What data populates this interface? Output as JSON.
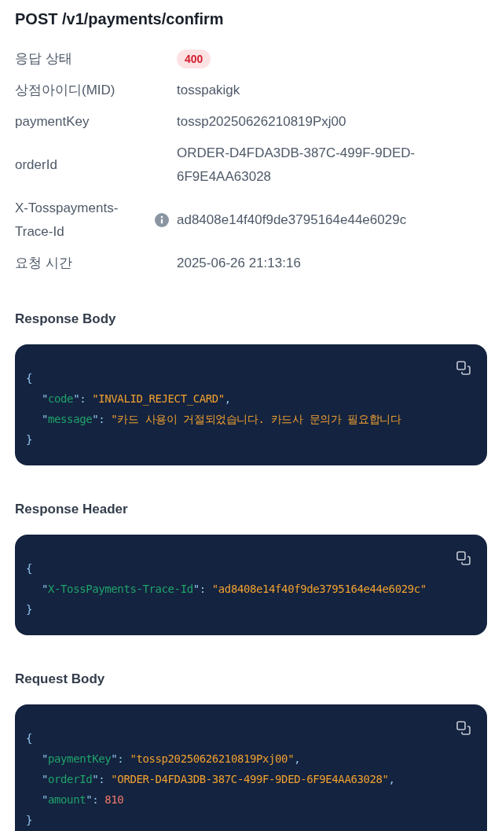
{
  "title": "POST /v1/payments/confirm",
  "fields": [
    {
      "label": "응답 상태",
      "kind": "badge",
      "value": "400",
      "info": false
    },
    {
      "label": "상점아이디(MID)",
      "kind": "text",
      "value": "tosspakigk",
      "info": false
    },
    {
      "label": "paymentKey",
      "kind": "text",
      "value": "tossp20250626210819Pxj00",
      "info": false
    },
    {
      "label": "orderId",
      "kind": "text",
      "value": "ORDER-D4FDA3DB-387C-499F-9DED-6F9E4AA63028",
      "info": false
    },
    {
      "label": "X-Tosspayments-Trace-Id",
      "kind": "text",
      "value": "ad8408e14f40f9de3795164e44e6029c",
      "info": true
    },
    {
      "label": "요청 시간",
      "kind": "text",
      "value": "2025-06-26 21:13:16",
      "info": false
    }
  ],
  "sections": [
    {
      "heading": "Response Body",
      "lines": [
        [
          {
            "kind": "punct",
            "text": "{"
          }
        ],
        [
          {
            "kind": "punct",
            "text": "\""
          },
          {
            "kind": "key",
            "text": "code"
          },
          {
            "kind": "punct",
            "text": "\": "
          },
          {
            "kind": "string",
            "text": "\"INVALID_REJECT_CARD\""
          },
          {
            "kind": "punct",
            "text": ","
          }
        ],
        [
          {
            "kind": "punct",
            "text": "\""
          },
          {
            "kind": "key",
            "text": "message"
          },
          {
            "kind": "punct",
            "text": "\": "
          },
          {
            "kind": "string",
            "text": "\"카드 사용이 거절되었습니다. 카드사 문의가 필요합니다"
          }
        ],
        [
          {
            "kind": "punct",
            "text": "}"
          }
        ]
      ]
    },
    {
      "heading": "Response Header",
      "lines": [
        [
          {
            "kind": "punct",
            "text": "{"
          }
        ],
        [
          {
            "kind": "punct",
            "text": "\""
          },
          {
            "kind": "key",
            "text": "X-TossPayments-Trace-Id"
          },
          {
            "kind": "punct",
            "text": "\": "
          },
          {
            "kind": "string",
            "text": "\"ad8408e14f40f9de3795164e44e6029c\""
          }
        ],
        [
          {
            "kind": "punct",
            "text": "}"
          }
        ]
      ]
    },
    {
      "heading": "Request Body",
      "lines": [
        [
          {
            "kind": "punct",
            "text": "{"
          }
        ],
        [
          {
            "kind": "punct",
            "text": "\""
          },
          {
            "kind": "key",
            "text": "paymentKey"
          },
          {
            "kind": "punct",
            "text": "\": "
          },
          {
            "kind": "string",
            "text": "\"tossp20250626210819Pxj00\""
          },
          {
            "kind": "punct",
            "text": ","
          }
        ],
        [
          {
            "kind": "punct",
            "text": "\""
          },
          {
            "kind": "key",
            "text": "orderId"
          },
          {
            "kind": "punct",
            "text": "\": "
          },
          {
            "kind": "string",
            "text": "\"ORDER-D4FDA3DB-387C-499F-9DED-6F9E4AA63028\""
          },
          {
            "kind": "punct",
            "text": ","
          }
        ],
        [
          {
            "kind": "punct",
            "text": "\""
          },
          {
            "kind": "key",
            "text": "amount"
          },
          {
            "kind": "punct",
            "text": "\": "
          },
          {
            "kind": "number",
            "text": "810"
          }
        ],
        [
          {
            "kind": "punct",
            "text": "}"
          }
        ]
      ]
    }
  ]
}
